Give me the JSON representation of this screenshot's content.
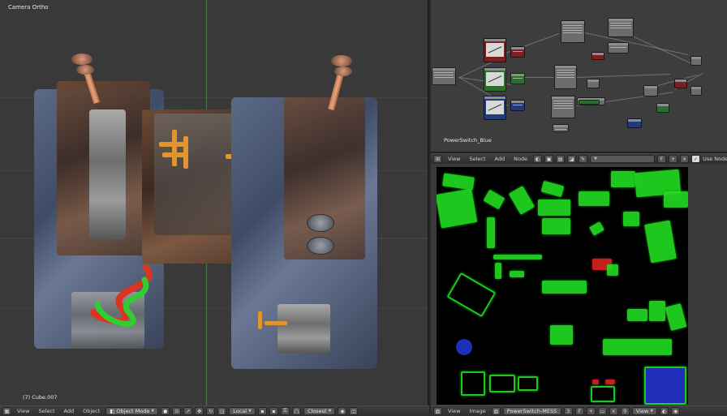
{
  "viewport3d": {
    "view_label": "Camera Ortho",
    "object_label": "(7) Cube.007"
  },
  "viewport_header": {
    "menus": [
      "View",
      "Select",
      "Add",
      "Object"
    ],
    "mode": "Object Mode",
    "pivot": "Local",
    "snap": "Closest"
  },
  "node_editor": {
    "node_tree_label": "PowerSwitch_Blue"
  },
  "node_header": {
    "menus": [
      "View",
      "Select",
      "Add",
      "Node"
    ],
    "use_nodes_label": "Use Nodes"
  },
  "image_header": {
    "menus": [
      "View",
      "Image"
    ],
    "image_name": "PowerSwitch-MESS",
    "view_label": "View"
  },
  "colors": {
    "uv_green": "#22dd22",
    "uv_red": "#dd2222",
    "uv_blue": "#2233cc"
  }
}
